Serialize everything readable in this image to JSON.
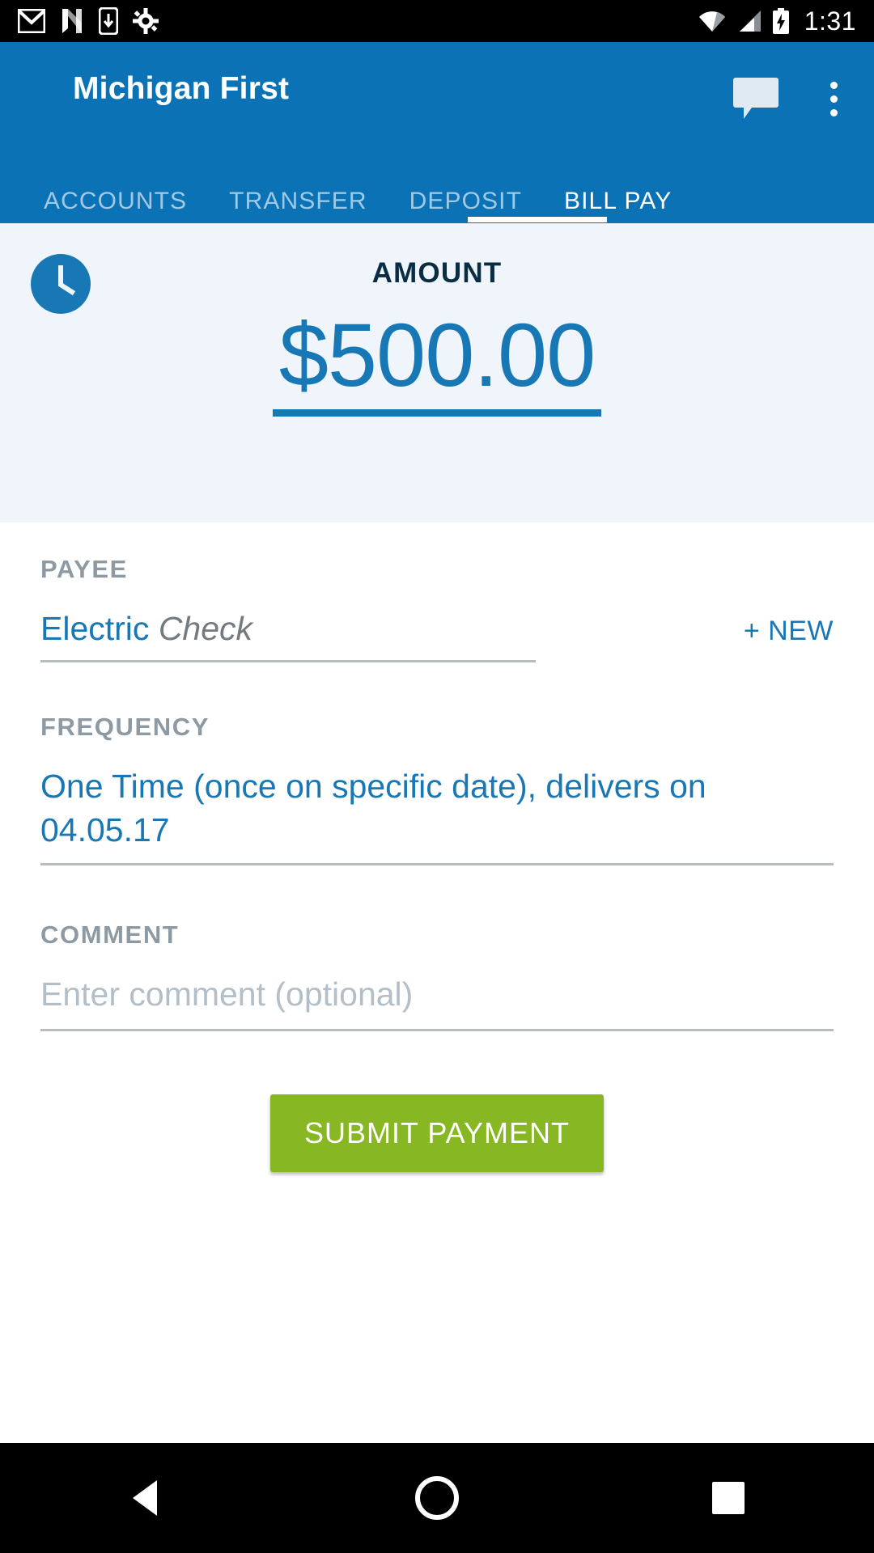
{
  "status_bar": {
    "time": "1:31",
    "left_icons": [
      "gmail-icon",
      "netflix-n-icon",
      "download-icon",
      "settings-gear-icon"
    ],
    "right_icons": [
      "wifi-icon",
      "cellular-signal-icon",
      "battery-charging-icon"
    ]
  },
  "app_bar": {
    "title": "Michigan First",
    "chat_icon": "chat-bubble-icon",
    "overflow_icon": "overflow-menu-icon",
    "background_color": "#0b72b5"
  },
  "tabs": {
    "items": [
      {
        "label": "ACCOUNTS",
        "active": false
      },
      {
        "label": "TRANSFER",
        "active": false
      },
      {
        "label": "DEPOSIT",
        "active": false
      },
      {
        "label": "BILL PAY",
        "active": true
      }
    ],
    "active_index": 3,
    "indicator_color": "#ffffff"
  },
  "amount_panel": {
    "clock_icon": "clock-icon",
    "label": "AMOUNT",
    "value": "$500.00",
    "accent_color": "#1878b5",
    "background_color": "#eff5fb",
    "label_color": "#0b2d44"
  },
  "form": {
    "payee": {
      "label": "PAYEE",
      "value_primary": "Electric",
      "value_secondary": "Check",
      "new_button": "+ NEW"
    },
    "frequency": {
      "label": "FREQUENCY",
      "value": "One Time (once on specific date), delivers on 04.05.17"
    },
    "comment": {
      "label": "COMMENT",
      "placeholder": "Enter comment (optional)",
      "value": ""
    },
    "submit": {
      "label": "SUBMIT PAYMENT",
      "color": "#87b723"
    }
  },
  "nav_bar": {
    "back": "back-triangle-icon",
    "home": "home-circle-icon",
    "recents": "recents-square-icon"
  }
}
